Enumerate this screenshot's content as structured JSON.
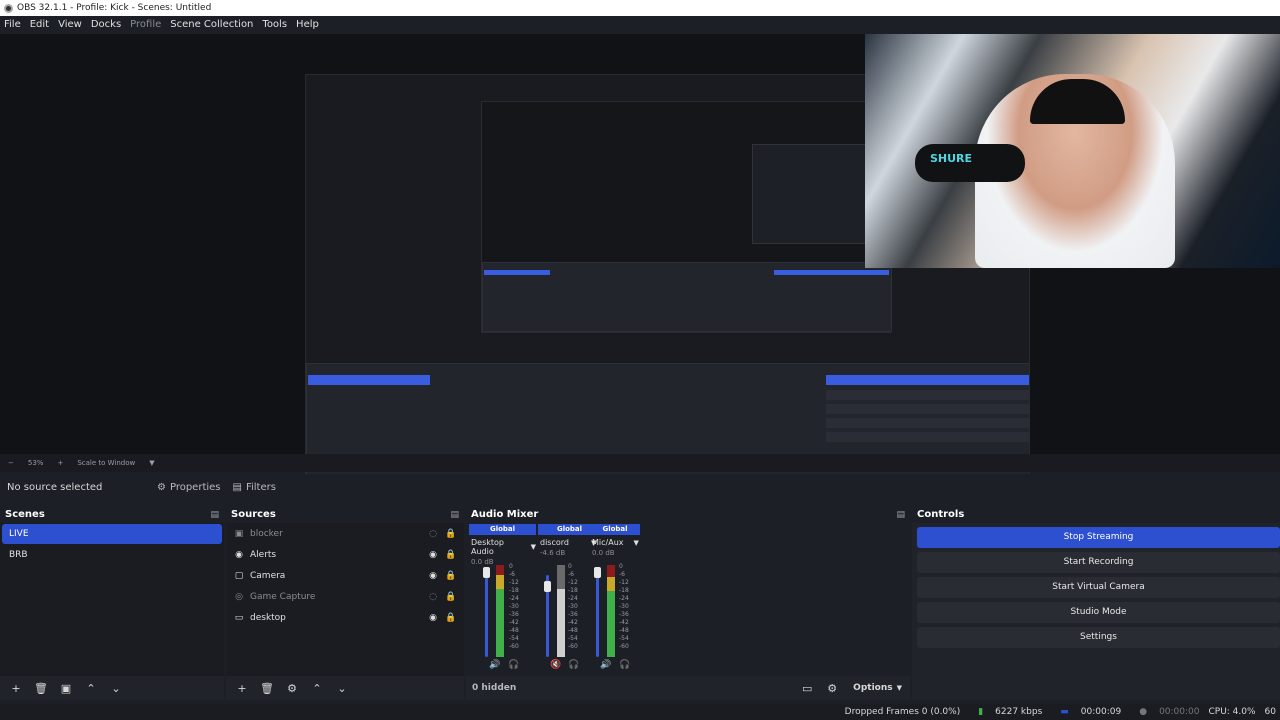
{
  "window": {
    "title": "OBS 32.1.1 - Profile: Kick - Scenes: Untitled"
  },
  "menu": [
    {
      "label": "File",
      "dim": false
    },
    {
      "label": "Edit",
      "dim": false
    },
    {
      "label": "View",
      "dim": false
    },
    {
      "label": "Docks",
      "dim": false
    },
    {
      "label": "Profile",
      "dim": true
    },
    {
      "label": "Scene Collection",
      "dim": false
    },
    {
      "label": "Tools",
      "dim": false
    },
    {
      "label": "Help",
      "dim": false
    }
  ],
  "webcam": {
    "mic_brand": "SHURE"
  },
  "preview_bar": {
    "zoom": "53%",
    "mode": "Scale to Window"
  },
  "source_toolbar": {
    "status": "No source selected",
    "properties": "Properties",
    "filters": "Filters"
  },
  "scenes": {
    "title": "Scenes",
    "items": [
      {
        "label": "LIVE",
        "active": true
      },
      {
        "label": "BRB",
        "active": false
      }
    ]
  },
  "sources": {
    "title": "Sources",
    "items": [
      {
        "label": "blocker",
        "icon": "image-icon",
        "visible": false
      },
      {
        "label": "Alerts",
        "icon": "browser-icon",
        "visible": true
      },
      {
        "label": "Camera",
        "icon": "camera-icon",
        "visible": true
      },
      {
        "label": "Game Capture",
        "icon": "gamepad-icon",
        "visible": false
      },
      {
        "label": "desktop",
        "icon": "monitor-icon",
        "visible": true
      }
    ]
  },
  "mixer": {
    "title": "Audio Mixer",
    "scale": [
      "0",
      "-6",
      "-12",
      "-18",
      "-24",
      "-30",
      "-36",
      "-42",
      "-48",
      "-54",
      "-60"
    ],
    "channels": [
      {
        "badge": "Global",
        "name": "Desktop Audio",
        "db": "0.0 dB",
        "muted": false
      },
      {
        "badge": "Global",
        "name": "discord",
        "db": "-4.6 dB",
        "muted": true
      },
      {
        "badge": "Global",
        "name": "Mic/Aux",
        "db": "0.0 dB",
        "muted": false
      }
    ],
    "hidden": "0 hidden",
    "options": "Options"
  },
  "controls": {
    "title": "Controls",
    "buttons": [
      {
        "label": "Stop Streaming",
        "primary": true
      },
      {
        "label": "Start Recording",
        "primary": false
      },
      {
        "label": "Start Virtual Camera",
        "primary": false
      },
      {
        "label": "Studio Mode",
        "primary": false
      },
      {
        "label": "Settings",
        "primary": false
      }
    ]
  },
  "status": {
    "dropped": "Dropped Frames 0 (0.0%)",
    "bitrate": "6227 kbps",
    "stream_time": "00:00:09",
    "rec_time": "00:00:00",
    "cpu": "CPU: 4.0%",
    "fps": "60"
  },
  "colors": {
    "accent": "#2c50d0",
    "background": "#1d1f26",
    "panel": "#21232b"
  }
}
